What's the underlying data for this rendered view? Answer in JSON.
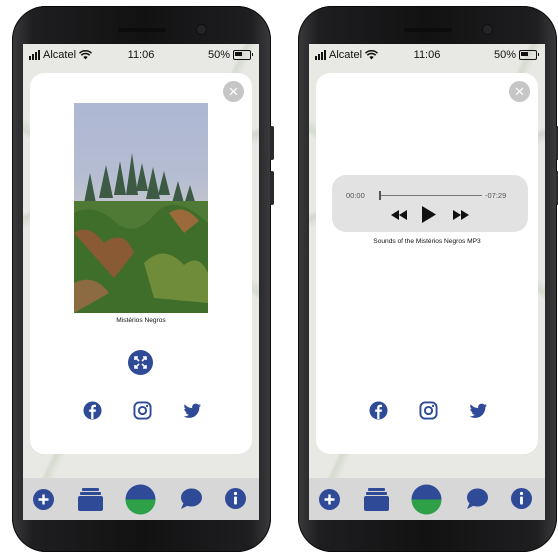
{
  "status": {
    "carrier": "Alcatel",
    "time": "11:06",
    "battery": "50%"
  },
  "left_phone": {
    "close_symbol": "×",
    "photo_caption": "Mistérios Negros",
    "icons": [
      "expand-icon",
      "facebook-icon",
      "instagram-icon",
      "twitter-icon"
    ]
  },
  "right_phone": {
    "close_symbol": "×",
    "player": {
      "current_time": "00:00",
      "remaining_time": "-07:29",
      "progress": 0
    },
    "audio_caption": "Sounds of the Mistérios Negros MP3"
  },
  "bottom_nav": {
    "items": [
      "add-icon",
      "layers-icon",
      "map-globe-icon",
      "chat-icon",
      "info-icon"
    ]
  },
  "colors": {
    "accent": "#2f4a96",
    "globe_green": "#2da048",
    "card": "#ffffff",
    "close_button": "#c6c6c6",
    "bottom_bar": "#d7d7d8"
  }
}
